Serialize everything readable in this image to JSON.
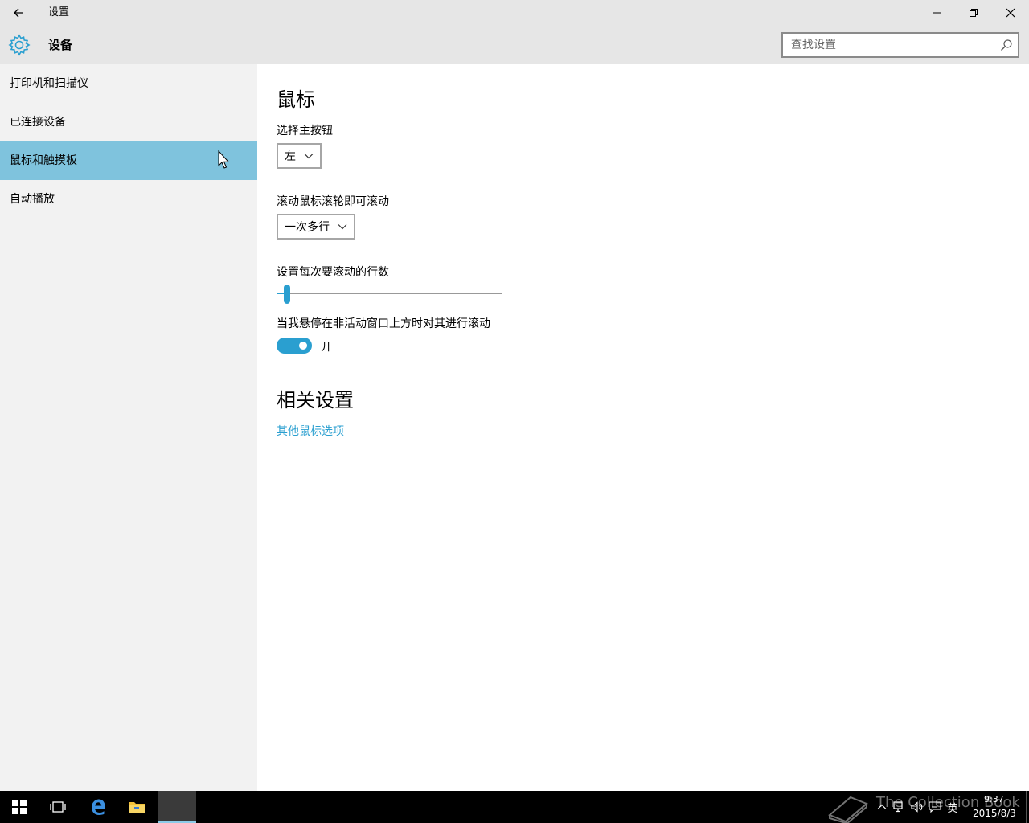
{
  "window": {
    "title": "设置"
  },
  "header": {
    "title": "设备",
    "search_placeholder": "查找设置"
  },
  "sidebar": {
    "items": [
      {
        "label": "打印机和扫描仪"
      },
      {
        "label": "已连接设备"
      },
      {
        "label": "鼠标和触摸板",
        "selected": true
      },
      {
        "label": "自动播放"
      }
    ]
  },
  "main": {
    "section_title": "鼠标",
    "primary_button": {
      "label": "选择主按钮",
      "value": "左"
    },
    "scroll_wheel": {
      "label": "滚动鼠标滚轮即可滚动",
      "value": "一次多行"
    },
    "lines_per_scroll": {
      "label": "设置每次要滚动的行数",
      "value_fraction": 0.03
    },
    "inactive_scroll": {
      "label": "当我悬停在非活动窗口上方时对其进行滚动",
      "state_label": "开",
      "on": true
    },
    "related": {
      "title": "相关设置",
      "link": "其他鼠标选项"
    }
  },
  "taskbar": {
    "tray_language": "英",
    "clock_time": "9:37",
    "clock_date": "2015/8/3",
    "watermark": "The Collection Book"
  },
  "colors": {
    "accent": "#2a9fd0",
    "selected_nav": "#7fc3dd"
  }
}
